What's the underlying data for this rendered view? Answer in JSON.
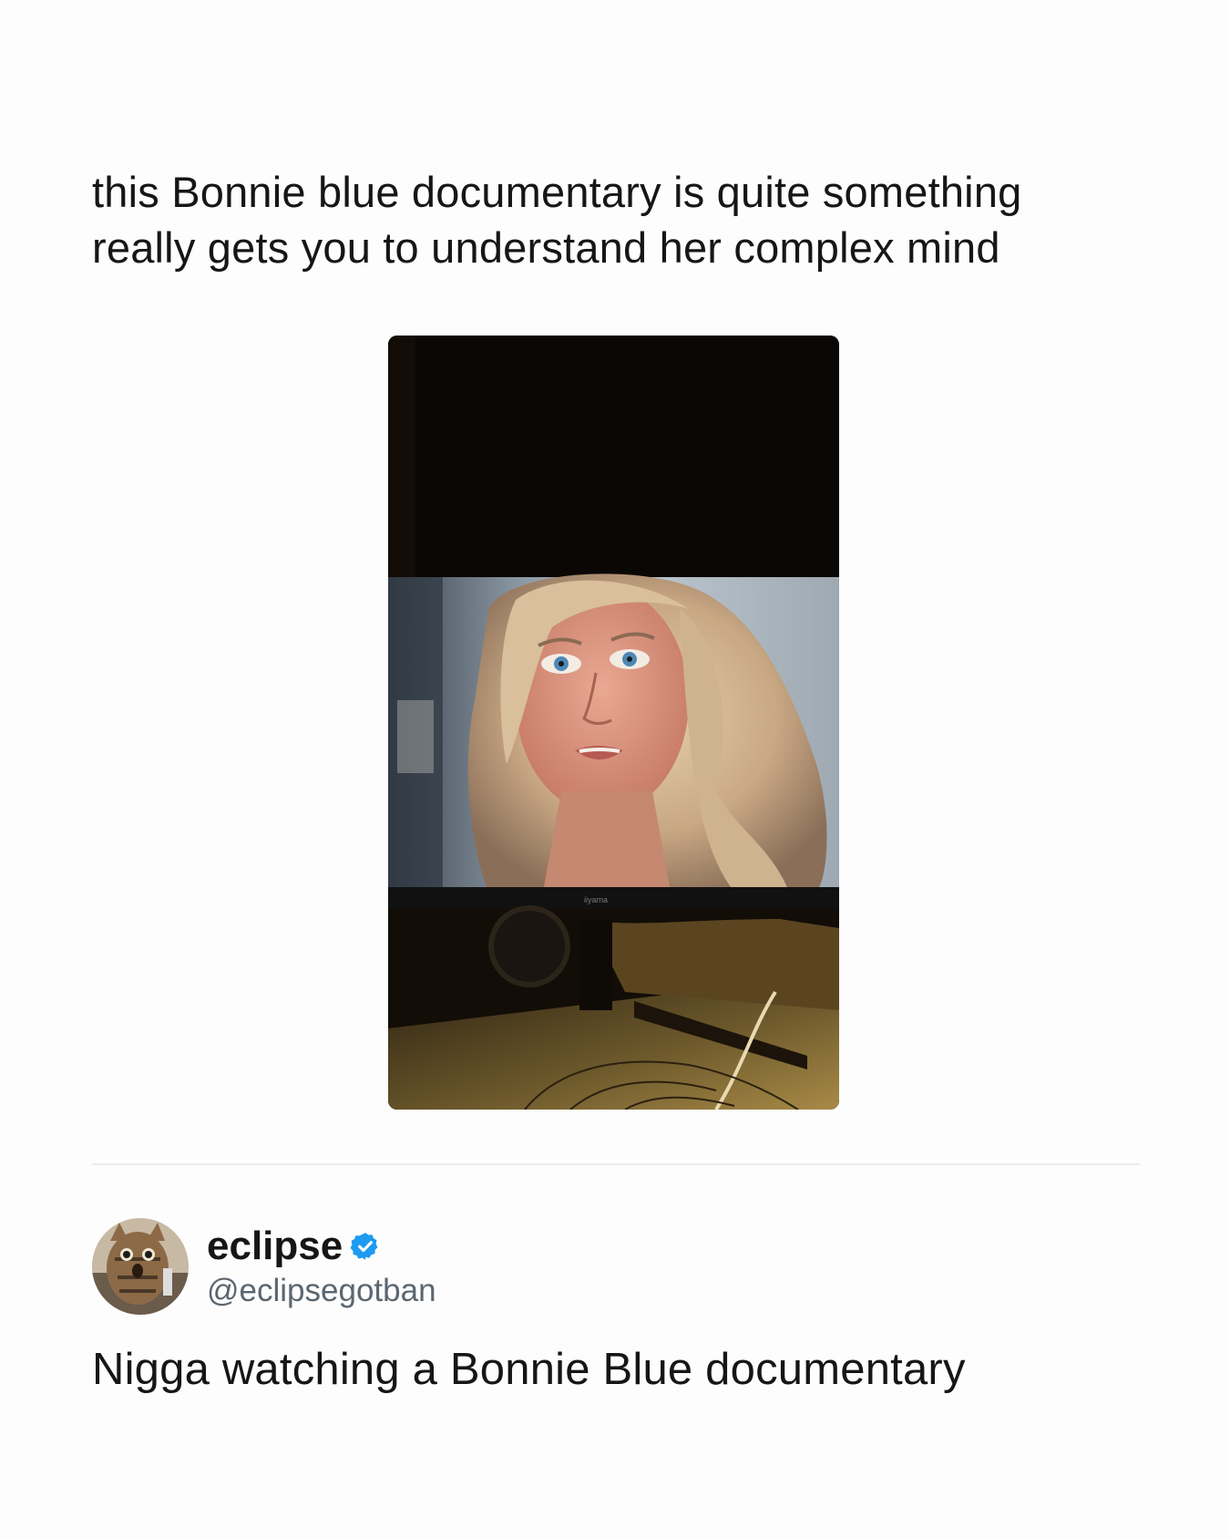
{
  "post": {
    "caption_line1": "this Bonnie blue documentary is quite something",
    "caption_line2": "really gets you to understand her complex mind",
    "media": {
      "monitor_brand": "iiyama"
    }
  },
  "reply": {
    "author": {
      "display_name": "eclipse",
      "handle": "@eclipsegotban",
      "verified": true,
      "avatar": "cat-photo-avatar"
    },
    "text": "Nigga watching a Bonnie Blue documentary"
  },
  "colors": {
    "verified_badge": "#1d9bf0",
    "handle_text": "#5b6670",
    "divider": "#ececec"
  },
  "icons": {
    "verified": "verified-badge-icon"
  }
}
